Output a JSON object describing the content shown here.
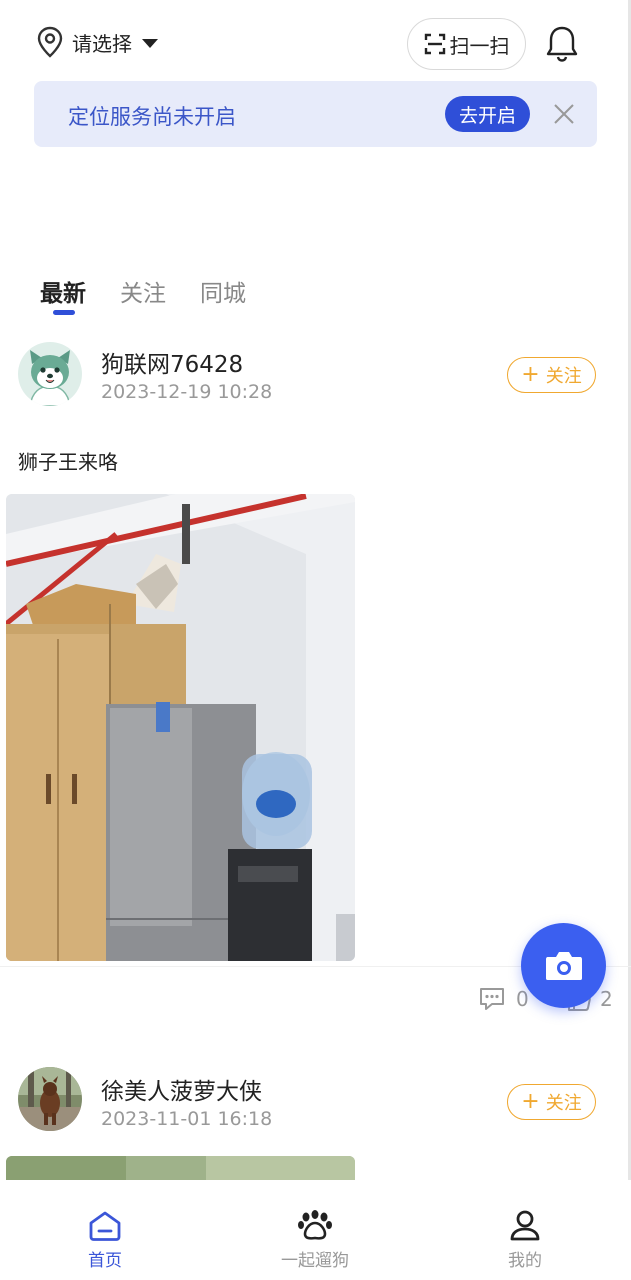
{
  "header": {
    "location_label": "请选择",
    "scan_label": "扫一扫"
  },
  "banner": {
    "text": "定位服务尚未开启",
    "button_label": "去开启"
  },
  "tabs": [
    {
      "label": "最新",
      "active": true
    },
    {
      "label": "关注",
      "active": false
    },
    {
      "label": "同城",
      "active": false
    }
  ],
  "posts": [
    {
      "username": "狗联网76428",
      "time": "2023-12-19 10:28",
      "follow_label": "关注",
      "text": "狮子王来咯",
      "comments": "0",
      "likes": "2"
    },
    {
      "username": "徐美人菠萝大侠",
      "time": "2023-11-01 16:18",
      "follow_label": "关注"
    }
  ],
  "bottom_nav": [
    {
      "label": "首页",
      "active": true
    },
    {
      "label": "一起遛狗",
      "active": false
    },
    {
      "label": "我的",
      "active": false
    }
  ],
  "colors": {
    "accent": "#2f4fd8",
    "follow": "#f0a830",
    "banner_bg": "#e7ebfa"
  }
}
